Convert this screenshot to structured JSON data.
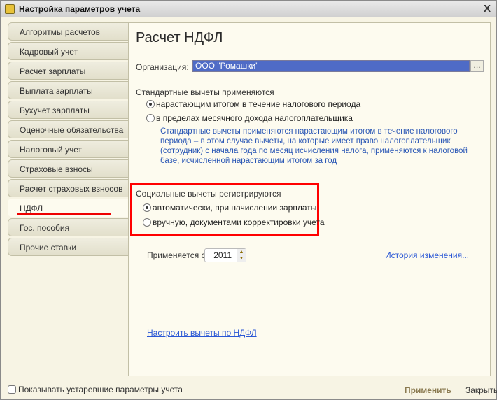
{
  "window": {
    "title": "Настройка параметров учета",
    "close": "X"
  },
  "tabs": [
    {
      "label": "Алгоритмы расчетов"
    },
    {
      "label": "Кадровый учет"
    },
    {
      "label": "Расчет зарплаты"
    },
    {
      "label": "Выплата зарплаты"
    },
    {
      "label": "Бухучет зарплаты"
    },
    {
      "label": "Оценочные обязательства"
    },
    {
      "label": "Налоговый учет"
    },
    {
      "label": "Страховые взносы"
    },
    {
      "label": "Расчет страховых взносов"
    },
    {
      "label": "НДФЛ"
    },
    {
      "label": "Гос. пособия"
    },
    {
      "label": "Прочие ставки"
    }
  ],
  "main": {
    "title": "Расчет НДФЛ",
    "org_label": "Организация:",
    "org_value": "ООО \"Ромашки\"",
    "org_button": "...",
    "std_label": "Стандартные вычеты применяются",
    "std_opt1": "нарастающим итогом в течение налогового периода",
    "std_opt2": "в пределах месячного дохода налогоплательщика",
    "std_note": "Стандартные вычеты применяются нарастающим итогом в течение налогового периода – в этом случае вычеты, на которые имеет право налогоплательщик (сотрудник) с начала года по месяц исчисления налога, применяются к налоговой базе, исчисленной нарастающим итогом за год",
    "soc_label": "Социальные вычеты регистрируются",
    "soc_opt1": "автоматически, при начислении зарплаты",
    "soc_opt2": "вручную, документами корректировки учета",
    "applies_label": "Применяется с:",
    "applies_value": "2011",
    "history_link": "История изменения...",
    "setup_link": "Настроить вычеты по НДФЛ"
  },
  "footer": {
    "checkbox": "Показывать устаревшие параметры учета",
    "apply": "Применить",
    "close": "Закрыть"
  },
  "colors": {
    "highlight": "#ff0000",
    "link": "#2a57d5",
    "selection": "#4f6bc6"
  }
}
